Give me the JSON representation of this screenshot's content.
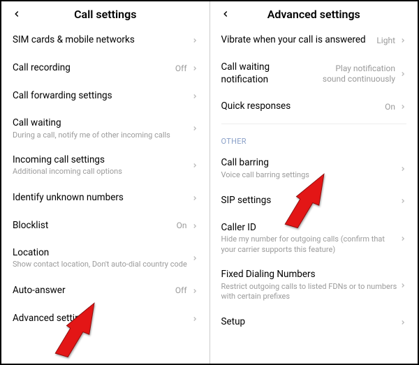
{
  "left": {
    "title": "Call settings",
    "items": [
      {
        "label": "SIM cards & mobile networks",
        "sub": "",
        "value": ""
      },
      {
        "label": "Call recording",
        "sub": "",
        "value": "Off"
      },
      {
        "label": "Call forwarding settings",
        "sub": "",
        "value": ""
      },
      {
        "label": "Call waiting",
        "sub": "During a call, notify me of other incoming calls",
        "value": ""
      },
      {
        "label": "Incoming call settings",
        "sub": "Additional incoming call options",
        "value": ""
      },
      {
        "label": "Identify unknown numbers",
        "sub": "",
        "value": ""
      },
      {
        "label": "Blocklist",
        "sub": "",
        "value": "On"
      },
      {
        "label": "Location",
        "sub": "Show contact location, Don't auto-dial country code",
        "value": ""
      },
      {
        "label": "Auto-answer",
        "sub": "",
        "value": "Off"
      },
      {
        "label": "Advanced settings",
        "sub": "",
        "value": ""
      }
    ]
  },
  "right": {
    "title": "Advanced settings",
    "items": [
      {
        "label": "Vibrate when your call is answered",
        "sub": "",
        "value": "Light"
      },
      {
        "label": "Call waiting notification",
        "sub": "",
        "value": "Play notification sound continuously"
      },
      {
        "label": "Quick responses",
        "sub": "",
        "value": "On"
      }
    ],
    "section": "OTHER",
    "other_items": [
      {
        "label": "Call barring",
        "sub": "Voice call barring settings",
        "value": ""
      },
      {
        "label": "SIP settings",
        "sub": "",
        "value": ""
      },
      {
        "label": "Caller ID",
        "sub": "Hide my number for outgoing calls (confirm that your carrier supports this feature)",
        "value": ""
      },
      {
        "label": "Fixed Dialing Numbers",
        "sub": "Restrict outgoing calls to listed FDNs or to numbers with certain prefixes",
        "value": ""
      },
      {
        "label": "Setup",
        "sub": "",
        "value": ""
      }
    ]
  }
}
